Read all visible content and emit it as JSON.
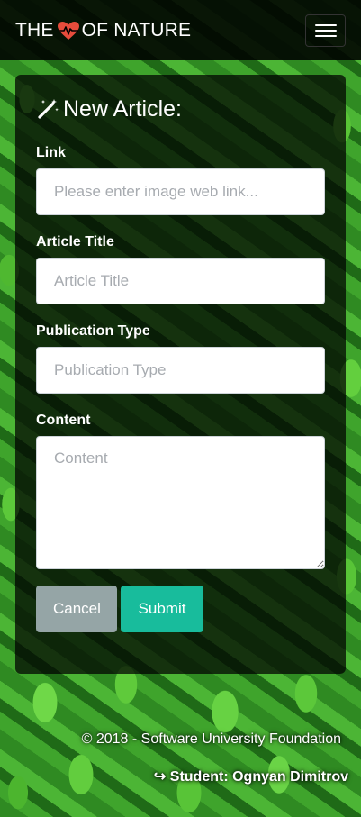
{
  "navbar": {
    "brand_prefix": "THE",
    "brand_suffix": "OF NATURE",
    "brand_heart_icon": "heart-pulse-icon",
    "menu_icon": "hamburger-icon"
  },
  "form": {
    "title": "New Article:",
    "title_icon": "magic-wand-icon",
    "fields": {
      "link": {
        "label": "Link",
        "placeholder": "Please enter image web link..."
      },
      "title": {
        "label": "Article Title",
        "placeholder": "Article Title"
      },
      "publication_type": {
        "label": "Publication Type",
        "placeholder": "Publication Type"
      },
      "content": {
        "label": "Content",
        "placeholder": "Content"
      }
    },
    "cancel_label": "Cancel",
    "submit_label": "Submit"
  },
  "footer": {
    "copyright": "© 2018 - Software University Foundation",
    "student": "↪ Student: Ognyan Dimitrov"
  },
  "colors": {
    "navbar_bg": "#000000",
    "heart": "#e74c3c",
    "cancel": "#95a5a6",
    "submit": "#18bc9c"
  }
}
